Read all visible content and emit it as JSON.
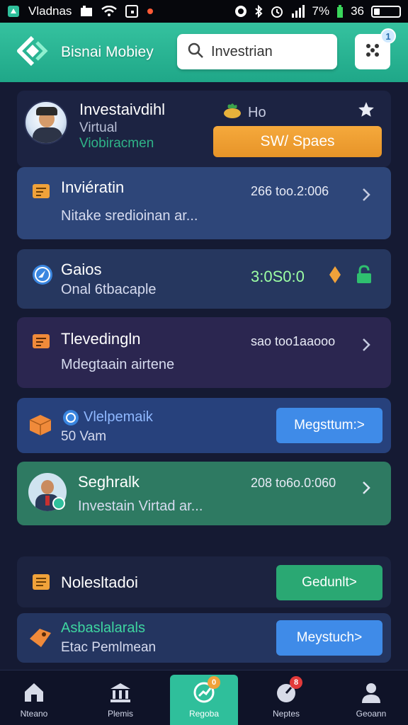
{
  "status_bar": {
    "carrier": "Vladnas",
    "battery_percent": "7%",
    "battery_level": "36"
  },
  "header": {
    "title": "Bisnai Mobiey",
    "search_value": "Investrian",
    "menu_badge": "1"
  },
  "profile": {
    "name": "Investaivdihl",
    "line1": "Virtual",
    "line2": "Viobiracmen",
    "tag": "Ho",
    "button": "SW/ Spaes"
  },
  "items": [
    {
      "title": "Inviératin",
      "subtitle": "Nitake sredioinan  ar...",
      "value": "266 too.2:006",
      "bg": "#2e4679"
    },
    {
      "title": "Gaios",
      "subtitle": "Onal 6tbacaple",
      "value": "3:0S0:0",
      "bg": "#26375f",
      "value_color": "#9dffa4"
    },
    {
      "title": "Tlevedingln",
      "subtitle": "Mdegtaain airtene",
      "value": "sao too1aaooo",
      "bg": "#2b2650"
    },
    {
      "title": "Vlelpemaik",
      "subtitle": "50 Vam",
      "button": "Megsttum:>",
      "bg": "#27417c"
    },
    {
      "title": "Seghralk",
      "subtitle": "Investain Virtad  ar...",
      "value": "208 to6o.0:060",
      "bg": "#2e7a62"
    },
    {
      "title": "Nolesltadoi",
      "button": "Gedunlt>",
      "bg": "#1c2340"
    },
    {
      "title": "Asbaslalarals",
      "subtitle": "Etac Pemlmean",
      "button": "Meystuch>",
      "bg": "#243560"
    }
  ],
  "nav": [
    {
      "label": "Nteano"
    },
    {
      "label": "Plemis"
    },
    {
      "label": "Regoba",
      "badge": "0"
    },
    {
      "label": "Neptes",
      "badge": "8"
    },
    {
      "label": "Geoann"
    }
  ],
  "colors": {
    "accent": "#2fbf9b",
    "orange": "#f0a23a",
    "blue_button": "#3f8be8",
    "green_button": "#2aa873"
  }
}
